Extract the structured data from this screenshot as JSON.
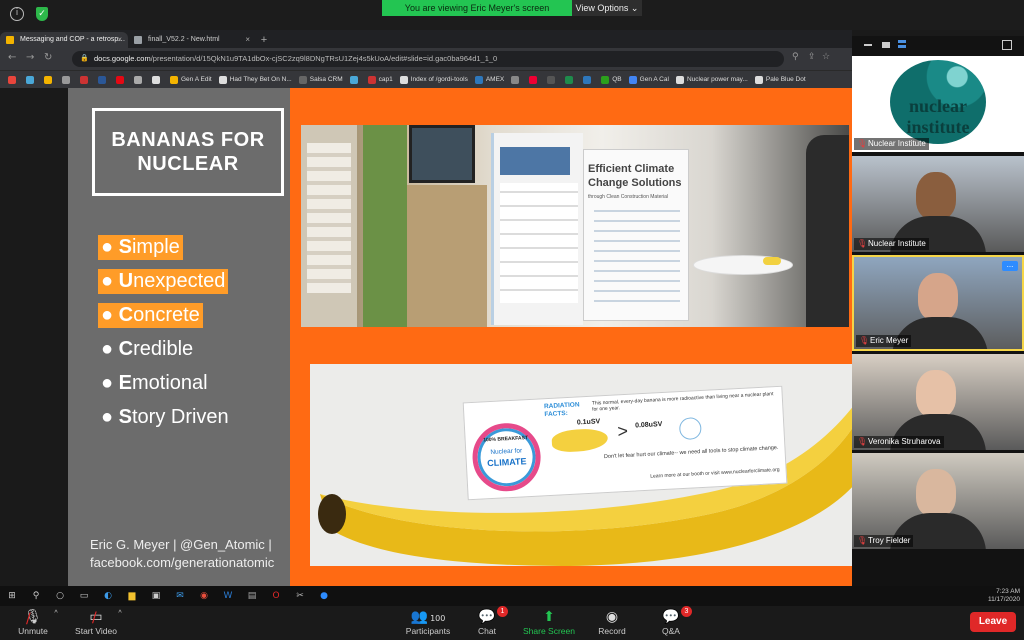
{
  "banner": {
    "viewing": "You are viewing Eric Meyer's screen",
    "view_options": "View Options ⌄"
  },
  "browser": {
    "tabs": [
      {
        "title": "Messaging and COP - a retrosp…",
        "fav": "#f4b400"
      },
      {
        "title": "finall_V52.2 - New.html",
        "fav": "#9aa0a6"
      }
    ],
    "url_host": "docs.google.com",
    "url_path": "/presentation/d/15QkN1u9TA1dbOx-cjSC2zq9l8DNgTRsU1Zej4s5kUoA/edit#slide=id.gac0ba964d1_1_0",
    "bookmarks": [
      {
        "label": "",
        "color": "#e8453c"
      },
      {
        "label": "",
        "color": "#4aa8d8"
      },
      {
        "label": "",
        "color": "#f4b400"
      },
      {
        "label": "",
        "color": "#999"
      },
      {
        "label": "",
        "color": "#c33"
      },
      {
        "label": "",
        "color": "#2b5797"
      },
      {
        "label": "",
        "color": "#e50914"
      },
      {
        "label": "",
        "color": "#aaa"
      },
      {
        "label": "",
        "color": "#ddd"
      },
      {
        "label": "Gen A Edit",
        "color": "#f4b400"
      },
      {
        "label": "Had They Bet On N...",
        "color": "#ddd"
      },
      {
        "label": "Salsa CRM",
        "color": "#666"
      },
      {
        "label": "",
        "color": "#4aa8d8"
      },
      {
        "label": "cap1",
        "color": "#c33"
      },
      {
        "label": "Index of /gordi-tools",
        "color": "#ddd"
      },
      {
        "label": "AMEX",
        "color": "#2e77bb"
      },
      {
        "label": "",
        "color": "#888"
      },
      {
        "label": "",
        "color": "#e03"
      },
      {
        "label": "",
        "color": "#555"
      },
      {
        "label": "",
        "color": "#1f8b4c"
      },
      {
        "label": "",
        "color": "#2e77bb"
      },
      {
        "label": "QB",
        "color": "#2ca01c"
      },
      {
        "label": "Gen A Cal",
        "color": "#4285f4"
      },
      {
        "label": "Nuclear power may...",
        "color": "#ddd"
      },
      {
        "label": "Pale Blue Dot",
        "color": "#ddd"
      }
    ]
  },
  "slide": {
    "title": "BANANAS FOR NUCLEAR",
    "bullets": [
      {
        "first": "S",
        "rest": "imple",
        "highlight": true
      },
      {
        "first": "U",
        "rest": "nexpected",
        "highlight": true
      },
      {
        "first": "C",
        "rest": "oncrete",
        "highlight": true
      },
      {
        "first": "C",
        "rest": "redible",
        "highlight": false
      },
      {
        "first": "E",
        "rest": "motional",
        "highlight": false
      },
      {
        "first": "S",
        "rest": "tory Driven",
        "highlight": false
      }
    ],
    "credit_line1": "Eric G. Meyer | @Gen_Atomic |",
    "credit_line2": "facebook.com/generationatomic",
    "booth_sign": "Efficient Climate Change Solutions",
    "booth_sub": "through Clean Construction Material",
    "sticker": {
      "badge_top": "100% BREAKFAST",
      "badge_mid": "Nuclear for",
      "badge_big": "CLIMATE",
      "facts_title": "RADIATION FACTS:",
      "facts_text": "This normal, every-day banana is more radioactive than living near a nuclear plant for one year.",
      "val_left": "0.1uSV",
      "gt": ">",
      "val_right": "0.08uSV",
      "tagline": "Don't let fear hurt our climate-- we need all tools to stop climate change.",
      "learn": "Learn more at our booth or visit www.nuclearforclimate.org"
    }
  },
  "participants": [
    {
      "name": "Nuclear Institute",
      "type": "logo",
      "logo_text": "nuclear institute"
    },
    {
      "name": "Nuclear Institute",
      "type": "video",
      "bg": "#b9c2cc",
      "skin": "#8a5e3e"
    },
    {
      "name": "Eric Meyer",
      "type": "video",
      "bg": "#8fa6bf",
      "skin": "#d6a58a",
      "selected": true
    },
    {
      "name": "Veronika Struharova",
      "type": "video",
      "bg": "#d8cfc4",
      "skin": "#e6c1a7"
    },
    {
      "name": "Troy Fielder",
      "type": "video",
      "bg": "#cfcac0",
      "skin": "#d9b79e"
    }
  ],
  "clock": {
    "time": "7:23 AM",
    "date": "11/17/2020"
  },
  "controls": {
    "unmute": "Unmute",
    "start_video": "Start Video",
    "participants_count": "100",
    "participants": "Participants",
    "chat": "Chat",
    "chat_badge": "1",
    "share": "Share Screen",
    "record": "Record",
    "qa": "Q&A",
    "qa_badge": "3",
    "leave": "Leave"
  },
  "colors": {
    "slide_orange": "#ff6a13",
    "highlight": "#ff9c28",
    "zoom_green": "#23c552",
    "leave_red": "#e02828",
    "share_green": "#23c552"
  }
}
